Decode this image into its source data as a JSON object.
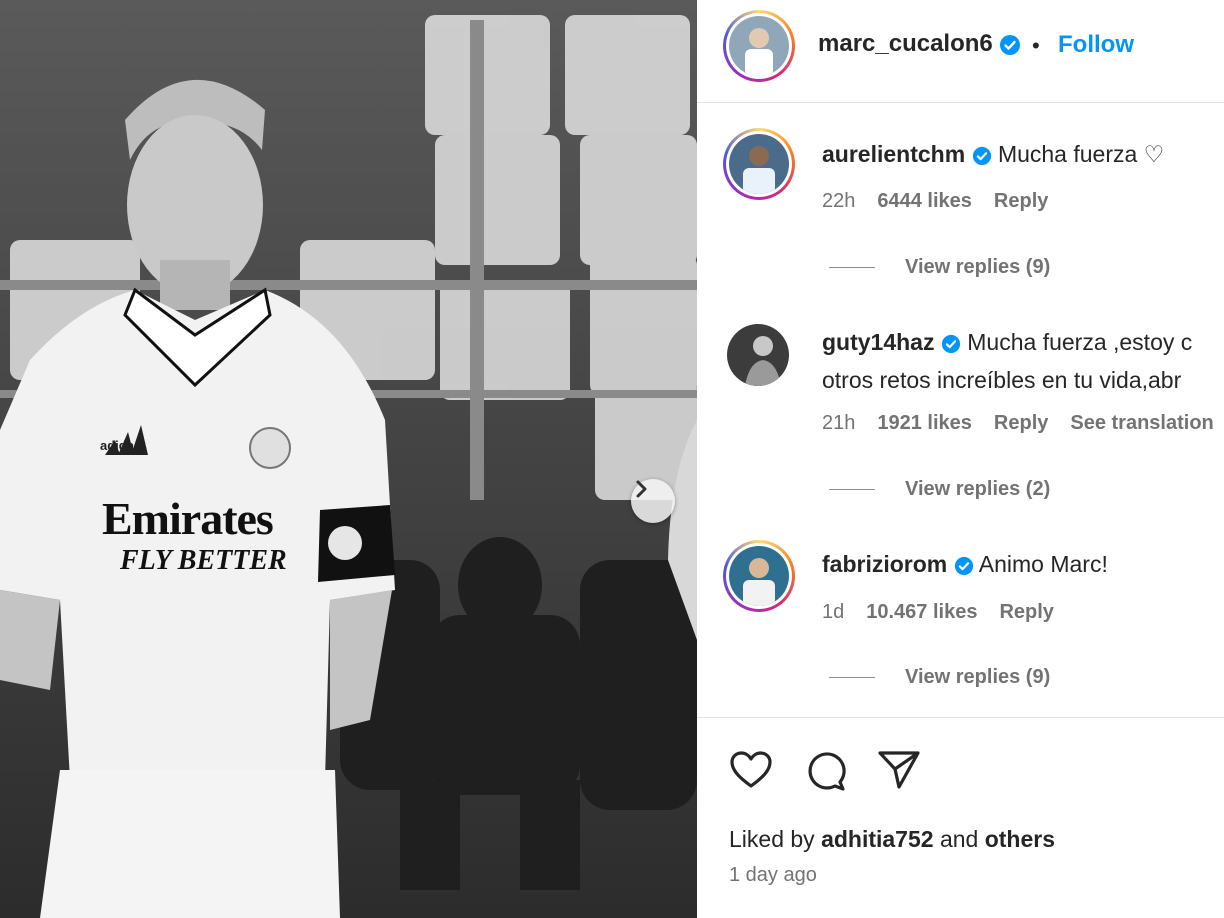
{
  "post": {
    "author": "marc_cucalon6",
    "follow_label": "Follow",
    "separator": "•"
  },
  "photo": {
    "jersey_sponsor_line1": "Emirates",
    "jersey_sponsor_line2": "FLY BETTER",
    "brand": "adidas"
  },
  "comments": [
    {
      "username": "aurelientchm",
      "text": "Mucha fuerza ♡",
      "time": "22h",
      "likes": "6444 likes",
      "reply_label": "Reply",
      "view_replies": "View replies (9)"
    },
    {
      "username": "guty14haz",
      "text": "Mucha fuerza ,estoy c",
      "text_line2": "otros retos increíbles en tu vida,abr",
      "time": "21h",
      "likes": "1921 likes",
      "reply_label": "Reply",
      "translation_label": "See translation",
      "view_replies": "View replies (2)"
    },
    {
      "username": "fabriziorom",
      "text": "Animo Marc!",
      "time": "1d",
      "likes": "10.467 likes",
      "reply_label": "Reply",
      "view_replies": "View replies (9)"
    }
  ],
  "footer": {
    "liked_by_prefix": "Liked by",
    "liked_by_user": "adhitia752",
    "liked_by_and": "and",
    "liked_by_others": "others",
    "time_ago": "1 day ago"
  },
  "icons": {
    "next": "chevron-right-icon",
    "like": "heart-icon",
    "comment": "comment-icon",
    "share": "paper-plane-icon",
    "verified": "verified-badge-icon"
  },
  "colors": {
    "follow": "#0095f6",
    "verified": "#0095f6",
    "muted": "#737373"
  }
}
